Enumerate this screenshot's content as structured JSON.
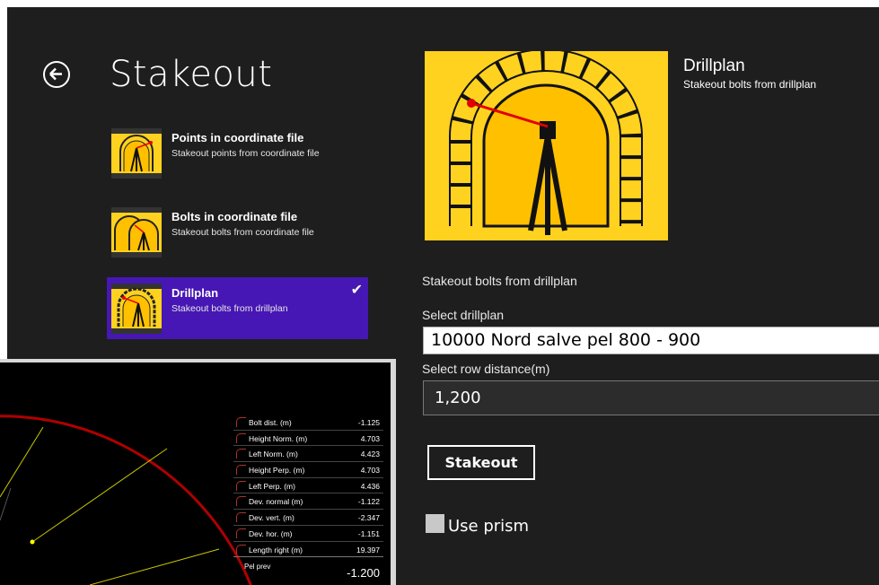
{
  "page_title": "Stakeout",
  "options": [
    {
      "title": "Points in coordinate file",
      "subtitle": "Stakeout points from coordinate file"
    },
    {
      "title": "Bolts in coordinate file",
      "subtitle": "Stakeout bolts from coordinate file"
    },
    {
      "title": "Drillplan",
      "subtitle": "Stakeout bolts from drillplan",
      "selected": true
    }
  ],
  "detail": {
    "title": "Drillplan",
    "subtitle": "Stakeout bolts from drillplan",
    "description": "Stakeout bolts from drillplan",
    "select_label": "Select drillplan",
    "select_value": "10000 Nord salve pel 800 - 900",
    "row_label": "Select row distance(m)",
    "row_value": "1,200",
    "stakeout_label": "Stakeout",
    "prism_label": "Use prism"
  },
  "measurements": [
    {
      "label": "Bolt dist. (m)",
      "value": "-1.125"
    },
    {
      "label": "Height Norm. (m)",
      "value": "4.703"
    },
    {
      "label": "Left Norm. (m)",
      "value": "4.423"
    },
    {
      "label": "Height Perp. (m)",
      "value": "4.703"
    },
    {
      "label": "Left Perp. (m)",
      "value": "4.436"
    },
    {
      "label": "Dev. normal (m)",
      "value": "-1.122"
    },
    {
      "label": "Dev. vert. (m)",
      "value": "-2.347"
    },
    {
      "label": "Dev. hor. (m)",
      "value": "-1.151"
    },
    {
      "label": "Length right (m)",
      "value": "19.397"
    }
  ],
  "pel": {
    "label": "Pel prev",
    "value": "-1.200"
  },
  "colors": {
    "accent": "#4617b4",
    "image_bg": "#ffd21f",
    "background": "#1e1e1e"
  }
}
